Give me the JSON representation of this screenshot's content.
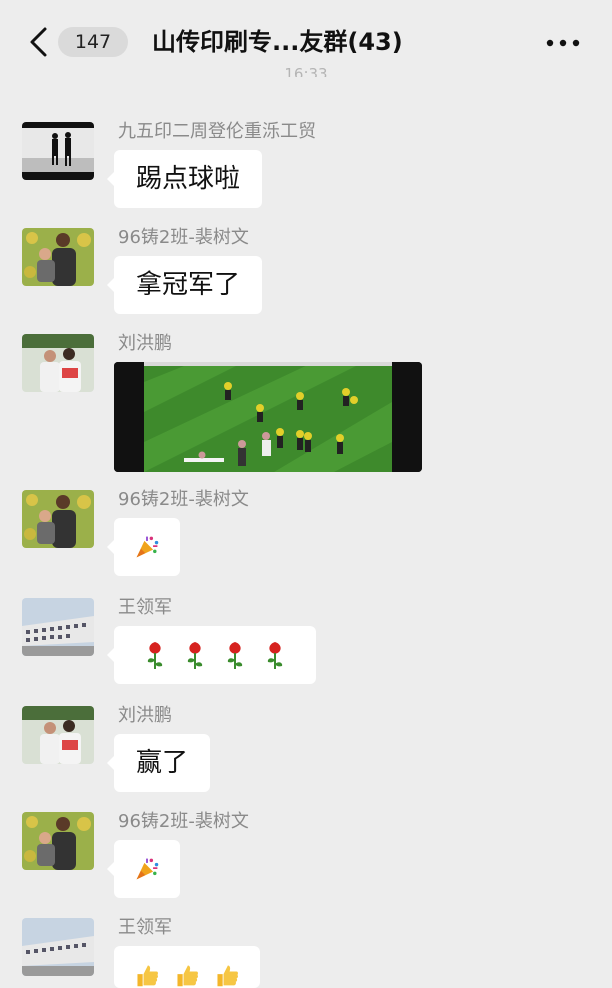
{
  "header": {
    "unread_count": "147",
    "title": "山传印刷专...友群(43)",
    "time": "16:33"
  },
  "messages": [
    {
      "sender": "九五印二周登伦重泺工贸",
      "text": "踢点球啦",
      "avatar": "silhouette-couple-avatar"
    },
    {
      "sender": "96铸2班-裴树文",
      "text": "拿冠军了",
      "avatar": "man-child-flowers-avatar"
    },
    {
      "sender": "刘洪鹏",
      "content": "soccer-video-thumbnail",
      "avatar": "couple-avatar"
    },
    {
      "sender": "96铸2班-裴树文",
      "content": "party-popper-emoji",
      "avatar": "man-child-flowers-avatar"
    },
    {
      "sender": "王领军",
      "content": "rose-emoji",
      "count": 4,
      "avatar": "building-avatar"
    },
    {
      "sender": "刘洪鹏",
      "text": "赢了",
      "avatar": "couple-avatar"
    },
    {
      "sender": "96铸2班-裴树文",
      "content": "party-popper-emoji",
      "avatar": "man-child-flowers-avatar"
    },
    {
      "sender": "王领军",
      "content": "thumbs-up-emoji",
      "count": 3,
      "avatar": "building-avatar"
    }
  ],
  "colors": {
    "background": "#ededed",
    "bubble": "#ffffff",
    "name_text": "#8a8a8a",
    "pitch_green": "#3e8a2c"
  }
}
